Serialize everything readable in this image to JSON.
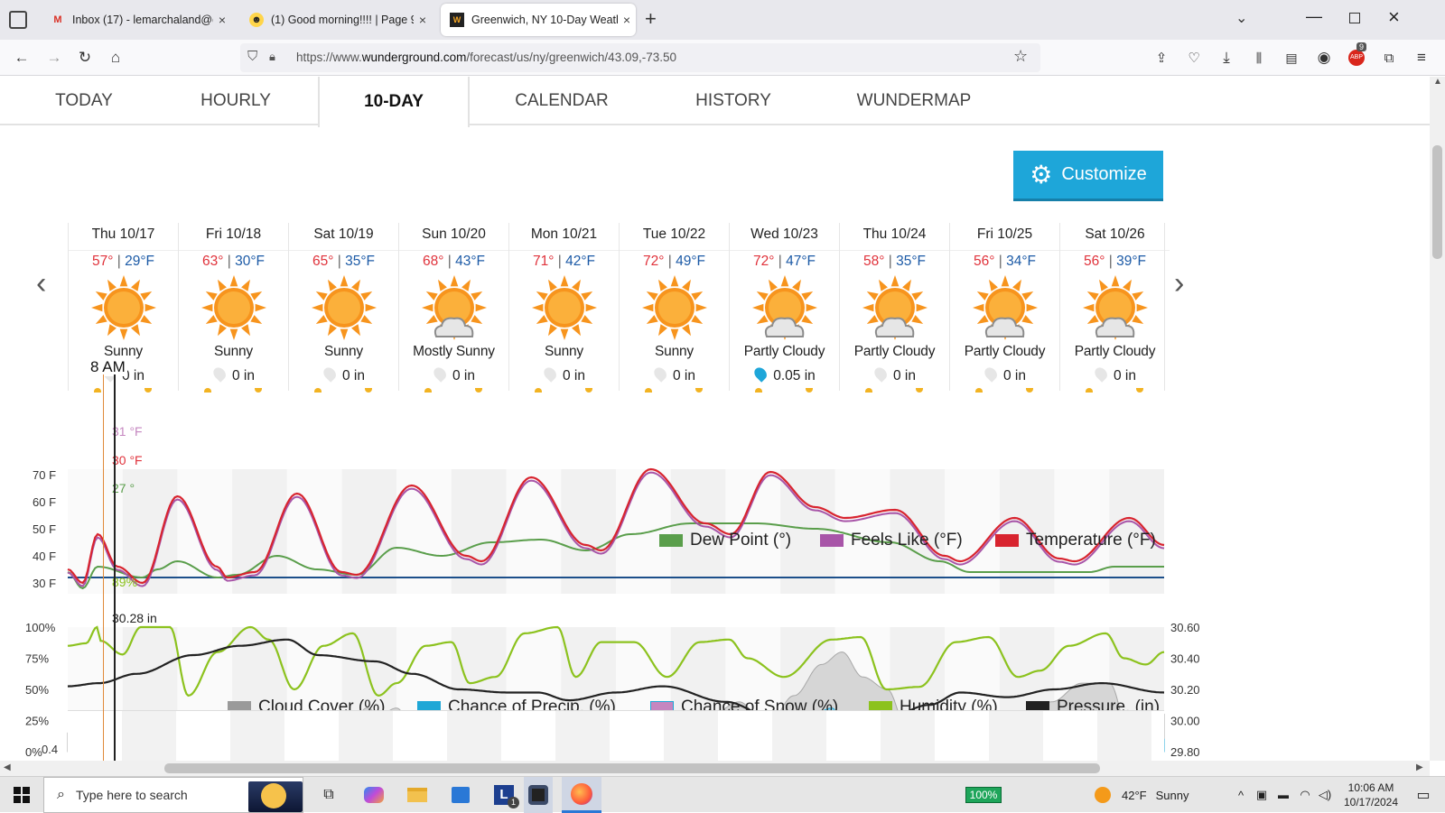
{
  "browser": {
    "tabs": [
      {
        "label": "Inbox (17) - lemarchaland@gm",
        "icon": "gmail-icon"
      },
      {
        "label": "(1) Good morning!!!! | Page 990",
        "icon": "forum-icon"
      },
      {
        "label": "Greenwich, NY 10-Day Weather",
        "icon": "wunderground-icon"
      }
    ],
    "url_prefix": "https://www.",
    "url_domain": "wunderground.com",
    "url_rest": "/forecast/us/ny/greenwich/43.09,-73.50",
    "abp_badge": "9"
  },
  "subnav": [
    "TODAY",
    "HOURLY",
    "10-DAY",
    "CALENDAR",
    "HISTORY",
    "WUNDERMAP"
  ],
  "customize_label": "Customize",
  "days": [
    {
      "date": "Thu 10/17",
      "hi": "57°",
      "lo": "29°F",
      "cond": "Sunny",
      "precip": "0 in",
      "cloud": false
    },
    {
      "date": "Fri 10/18",
      "hi": "63°",
      "lo": "30°F",
      "cond": "Sunny",
      "precip": "0 in",
      "cloud": false
    },
    {
      "date": "Sat 10/19",
      "hi": "65°",
      "lo": "35°F",
      "cond": "Sunny",
      "precip": "0 in",
      "cloud": false
    },
    {
      "date": "Sun 10/20",
      "hi": "68°",
      "lo": "43°F",
      "cond": "Mostly Sunny",
      "precip": "0 in",
      "cloud": true
    },
    {
      "date": "Mon 10/21",
      "hi": "71°",
      "lo": "42°F",
      "cond": "Sunny",
      "precip": "0 in",
      "cloud": false
    },
    {
      "date": "Tue 10/22",
      "hi": "72°",
      "lo": "49°F",
      "cond": "Sunny",
      "precip": "0 in",
      "cloud": false
    },
    {
      "date": "Wed 10/23",
      "hi": "72°",
      "lo": "47°F",
      "cond": "Partly Cloudy",
      "precip": "0.05 in",
      "cloud": true
    },
    {
      "date": "Thu 10/24",
      "hi": "58°",
      "lo": "35°F",
      "cond": "Partly Cloudy",
      "precip": "0 in",
      "cloud": true
    },
    {
      "date": "Fri 10/25",
      "hi": "56°",
      "lo": "34°F",
      "cond": "Partly Cloudy",
      "precip": "0 in",
      "cloud": true
    },
    {
      "date": "Sat 10/26",
      "hi": "56°",
      "lo": "39°F",
      "cond": "Partly Cloudy",
      "precip": "0 in",
      "cloud": true
    }
  ],
  "hover": {
    "time": "8 AM",
    "feels": "31 °F",
    "temp": "30 °F",
    "dew": "27 °",
    "humidity": "89%",
    "pressure": "30.28 in"
  },
  "chart_data": [
    {
      "type": "line",
      "x": [
        "Thu 10/17",
        "Fri 10/18",
        "Sat 10/19",
        "Sun 10/20",
        "Mon 10/21",
        "Tue 10/22",
        "Wed 10/23",
        "Thu 10/24",
        "Fri 10/25",
        "Sat 10/26"
      ],
      "y_ticks": [
        "70 F",
        "60 F",
        "50 F",
        "40 F",
        "30 F"
      ],
      "ylim": [
        26,
        72
      ],
      "series": [
        {
          "name": "Dew Point (°)",
          "color": "#5a9e4b"
        },
        {
          "name": "Feels Like (°F)",
          "color": "#a855a8"
        },
        {
          "name": "Temperature (°F)",
          "color": "#d8242f"
        }
      ],
      "hourly_temperature_keypoints": [
        [
          0,
          35
        ],
        [
          6,
          30
        ],
        [
          12,
          48
        ],
        [
          20,
          36
        ],
        [
          30,
          30
        ],
        [
          44,
          62
        ],
        [
          60,
          36
        ],
        [
          64,
          32
        ],
        [
          75,
          34
        ],
        [
          92,
          63
        ],
        [
          110,
          34
        ],
        [
          116,
          33
        ],
        [
          138,
          66
        ],
        [
          160,
          40
        ],
        [
          166,
          38
        ],
        [
          186,
          69
        ],
        [
          208,
          44
        ],
        [
          214,
          42
        ],
        [
          234,
          72
        ],
        [
          256,
          52
        ],
        [
          266,
          48
        ],
        [
          282,
          71
        ],
        [
          300,
          58
        ],
        [
          312,
          54
        ],
        [
          332,
          57
        ],
        [
          352,
          40
        ],
        [
          358,
          38
        ],
        [
          380,
          54
        ],
        [
          398,
          39
        ],
        [
          404,
          38
        ],
        [
          426,
          54
        ],
        [
          440,
          44
        ]
      ],
      "hourly_dew_keypoints": [
        [
          0,
          34
        ],
        [
          6,
          28
        ],
        [
          12,
          36
        ],
        [
          30,
          32
        ],
        [
          36,
          35
        ],
        [
          44,
          38
        ],
        [
          60,
          32
        ],
        [
          68,
          33
        ],
        [
          84,
          40
        ],
        [
          100,
          35
        ],
        [
          116,
          33
        ],
        [
          132,
          43
        ],
        [
          150,
          40
        ],
        [
          170,
          45
        ],
        [
          190,
          46
        ],
        [
          208,
          42
        ],
        [
          226,
          48
        ],
        [
          250,
          52
        ],
        [
          276,
          52
        ],
        [
          300,
          50
        ],
        [
          330,
          45
        ],
        [
          350,
          38
        ],
        [
          362,
          34
        ],
        [
          390,
          34
        ],
        [
          410,
          34
        ],
        [
          420,
          36
        ],
        [
          440,
          36
        ]
      ],
      "threshold_line": 32
    },
    {
      "type": "area",
      "x": [
        "Thu 10/17",
        "Fri 10/18",
        "Sat 10/19",
        "Sun 10/20",
        "Mon 10/21",
        "Tue 10/22",
        "Wed 10/23",
        "Thu 10/24",
        "Fri 10/25",
        "Sat 10/26"
      ],
      "y_ticks_left": [
        "100%",
        "75%",
        "50%",
        "25%",
        "0%"
      ],
      "y_ticks_right": [
        "30.60",
        "30.40",
        "30.20",
        "30.00",
        "29.80"
      ],
      "ylim_left": [
        0,
        100
      ],
      "ylim_right": [
        29.8,
        30.6
      ],
      "series": [
        {
          "name": "Cloud Cover (%)",
          "color": "#9a9a9a"
        },
        {
          "name": "Chance of Precip. (%)",
          "color": "#1fa7d6"
        },
        {
          "name": "Chance of Snow (%)",
          "color": "#c586c0"
        },
        {
          "name": "Humidity (%)",
          "color": "#8cc21e"
        },
        {
          "name": "Pressure. (in)",
          "color": "#222222"
        }
      ],
      "humidity_keypoints": [
        [
          0,
          85
        ],
        [
          10,
          87
        ],
        [
          16,
          100
        ],
        [
          18,
          89
        ],
        [
          30,
          78
        ],
        [
          40,
          100
        ],
        [
          56,
          100
        ],
        [
          66,
          45
        ],
        [
          82,
          80
        ],
        [
          100,
          100
        ],
        [
          110,
          90
        ],
        [
          124,
          50
        ],
        [
          140,
          85
        ],
        [
          156,
          95
        ],
        [
          170,
          45
        ],
        [
          180,
          55
        ],
        [
          196,
          85
        ],
        [
          210,
          88
        ],
        [
          220,
          55
        ],
        [
          234,
          60
        ],
        [
          250,
          95
        ],
        [
          268,
          100
        ],
        [
          278,
          60
        ],
        [
          292,
          88
        ],
        [
          310,
          88
        ],
        [
          328,
          60
        ],
        [
          346,
          88
        ],
        [
          362,
          90
        ],
        [
          372,
          75
        ],
        [
          392,
          60
        ],
        [
          418,
          90
        ],
        [
          434,
          92
        ],
        [
          448,
          50
        ],
        [
          466,
          52
        ],
        [
          486,
          88
        ],
        [
          504,
          92
        ],
        [
          520,
          60
        ],
        [
          532,
          65
        ],
        [
          548,
          85
        ],
        [
          568,
          95
        ],
        [
          578,
          75
        ],
        [
          590,
          70
        ],
        [
          600,
          80
        ]
      ],
      "pressure_keypoints": [
        [
          0,
          30.22
        ],
        [
          20,
          30.24
        ],
        [
          44,
          30.3
        ],
        [
          80,
          30.42
        ],
        [
          110,
          30.48
        ],
        [
          140,
          30.52
        ],
        [
          160,
          30.42
        ],
        [
          196,
          30.38
        ],
        [
          220,
          30.3
        ],
        [
          250,
          30.2
        ],
        [
          280,
          30.18
        ],
        [
          300,
          30.18
        ],
        [
          320,
          30.13
        ],
        [
          350,
          30.18
        ],
        [
          380,
          30.22
        ],
        [
          420,
          30.12
        ],
        [
          450,
          30.02
        ],
        [
          460,
          29.86
        ],
        [
          480,
          29.88
        ],
        [
          500,
          29.95
        ],
        [
          520,
          30.0
        ],
        [
          550,
          30.1
        ],
        [
          570,
          30.18
        ],
        [
          600,
          30.15
        ],
        [
          630,
          30.2
        ],
        [
          660,
          30.24
        ],
        [
          700,
          30.18
        ]
      ],
      "cloud_keypoints": [
        [
          0,
          15
        ],
        [
          10,
          5
        ],
        [
          30,
          0
        ],
        [
          140,
          0
        ],
        [
          150,
          20
        ],
        [
          160,
          10
        ],
        [
          200,
          0
        ],
        [
          218,
          35
        ],
        [
          228,
          30
        ],
        [
          240,
          35
        ],
        [
          252,
          20
        ],
        [
          270,
          0
        ],
        [
          300,
          5
        ],
        [
          320,
          15
        ],
        [
          340,
          5
        ],
        [
          360,
          0
        ],
        [
          388,
          0
        ],
        [
          400,
          15
        ],
        [
          410,
          5
        ],
        [
          440,
          10
        ],
        [
          470,
          30
        ],
        [
          490,
          40
        ],
        [
          510,
          20
        ],
        [
          530,
          45
        ],
        [
          550,
          70
        ],
        [
          565,
          80
        ],
        [
          580,
          60
        ],
        [
          598,
          50
        ],
        [
          612,
          20
        ],
        [
          640,
          20
        ],
        [
          660,
          30
        ],
        [
          680,
          15
        ],
        [
          700,
          30
        ],
        [
          718,
          40
        ],
        [
          740,
          55
        ],
        [
          760,
          55
        ],
        [
          778,
          0
        ],
        [
          800,
          30
        ]
      ],
      "precip_keypoints": [
        [
          0,
          0
        ],
        [
          60,
          5
        ],
        [
          120,
          3
        ],
        [
          180,
          8
        ],
        [
          240,
          5
        ],
        [
          300,
          0
        ],
        [
          400,
          5
        ],
        [
          460,
          10
        ],
        [
          510,
          25
        ],
        [
          530,
          35
        ],
        [
          540,
          10
        ],
        [
          560,
          20
        ],
        [
          600,
          10
        ],
        [
          640,
          15
        ],
        [
          680,
          20
        ],
        [
          720,
          15
        ],
        [
          760,
          10
        ]
      ]
    }
  ],
  "bottom_tick": "0.4",
  "taskbar": {
    "search_placeholder": "Type here to search",
    "battery": "100%",
    "weather_temp": "42°F",
    "weather_cond": "Sunny",
    "time": "10:06 AM",
    "date": "10/17/2024",
    "badge": "1"
  }
}
